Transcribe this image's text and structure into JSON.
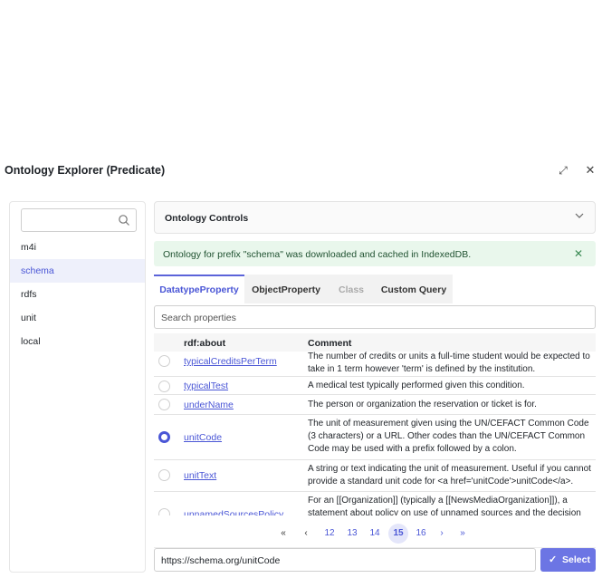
{
  "modal": {
    "title": "Ontology Explorer (Predicate)",
    "expand_icon": "⤢",
    "close_icon": "✕"
  },
  "left": {
    "search_value": "",
    "prefixes": [
      {
        "label": "m4i",
        "selected": false
      },
      {
        "label": "schema",
        "selected": true
      },
      {
        "label": "rdfs",
        "selected": false
      },
      {
        "label": "unit",
        "selected": false
      },
      {
        "label": "local",
        "selected": false
      }
    ]
  },
  "controls": {
    "label": "Ontology Controls",
    "chevron": "⌄"
  },
  "alert": {
    "text": "Ontology for prefix \"schema\" was downloaded and cached in IndexedDB.",
    "close": "✕",
    "color": "#e9f7ec"
  },
  "tabs": [
    {
      "label": "DatatypeProperty",
      "state": "active"
    },
    {
      "label": "ObjectProperty",
      "state": "normal"
    },
    {
      "label": "Class",
      "state": "disabled"
    },
    {
      "label": "Custom Query",
      "state": "normal"
    }
  ],
  "search": {
    "placeholder": "Search properties"
  },
  "table": {
    "headers": [
      "rdf:about",
      "Comment"
    ],
    "rows": [
      {
        "name": "typicalCreditsPerTerm",
        "comment": "The number of credits or units a full-time student would be expected to take in 1 term however 'term' is defined by the institution.",
        "selected": false
      },
      {
        "name": "typicalTest",
        "comment": "A medical test typically performed given this condition.",
        "selected": false
      },
      {
        "name": "underName",
        "comment": "The person or organization the reservation or ticket is for.",
        "selected": false
      },
      {
        "name": "unitCode",
        "comment": "The unit of measurement given using the UN/CEFACT Common Code (3 characters) or a URL. Other codes than the UN/CEFACT Common Code may be used with a prefix followed by a colon.",
        "selected": true
      },
      {
        "name": "unitText",
        "comment": "A string or text indicating the unit of measurement. Useful if you cannot provide a standard unit code for <a href='unitCode'>unitCode</a>.",
        "selected": false
      },
      {
        "name": "unnamedSourcesPolicy",
        "comment": "For an [[Organization]] (typically a [[NewsMediaOrganization]]), a statement about policy on use of unnamed sources and the decision process required.",
        "selected": false
      }
    ]
  },
  "pager": {
    "first": "«",
    "prev": "‹",
    "pages": [
      "12",
      "13",
      "14",
      "15",
      "16"
    ],
    "current": "15",
    "next": "›",
    "last": "»"
  },
  "footer": {
    "url_value": "https://schema.org/unitCode",
    "select_label": "Select",
    "select_icon": "✓",
    "accent": "#6c75e4"
  }
}
